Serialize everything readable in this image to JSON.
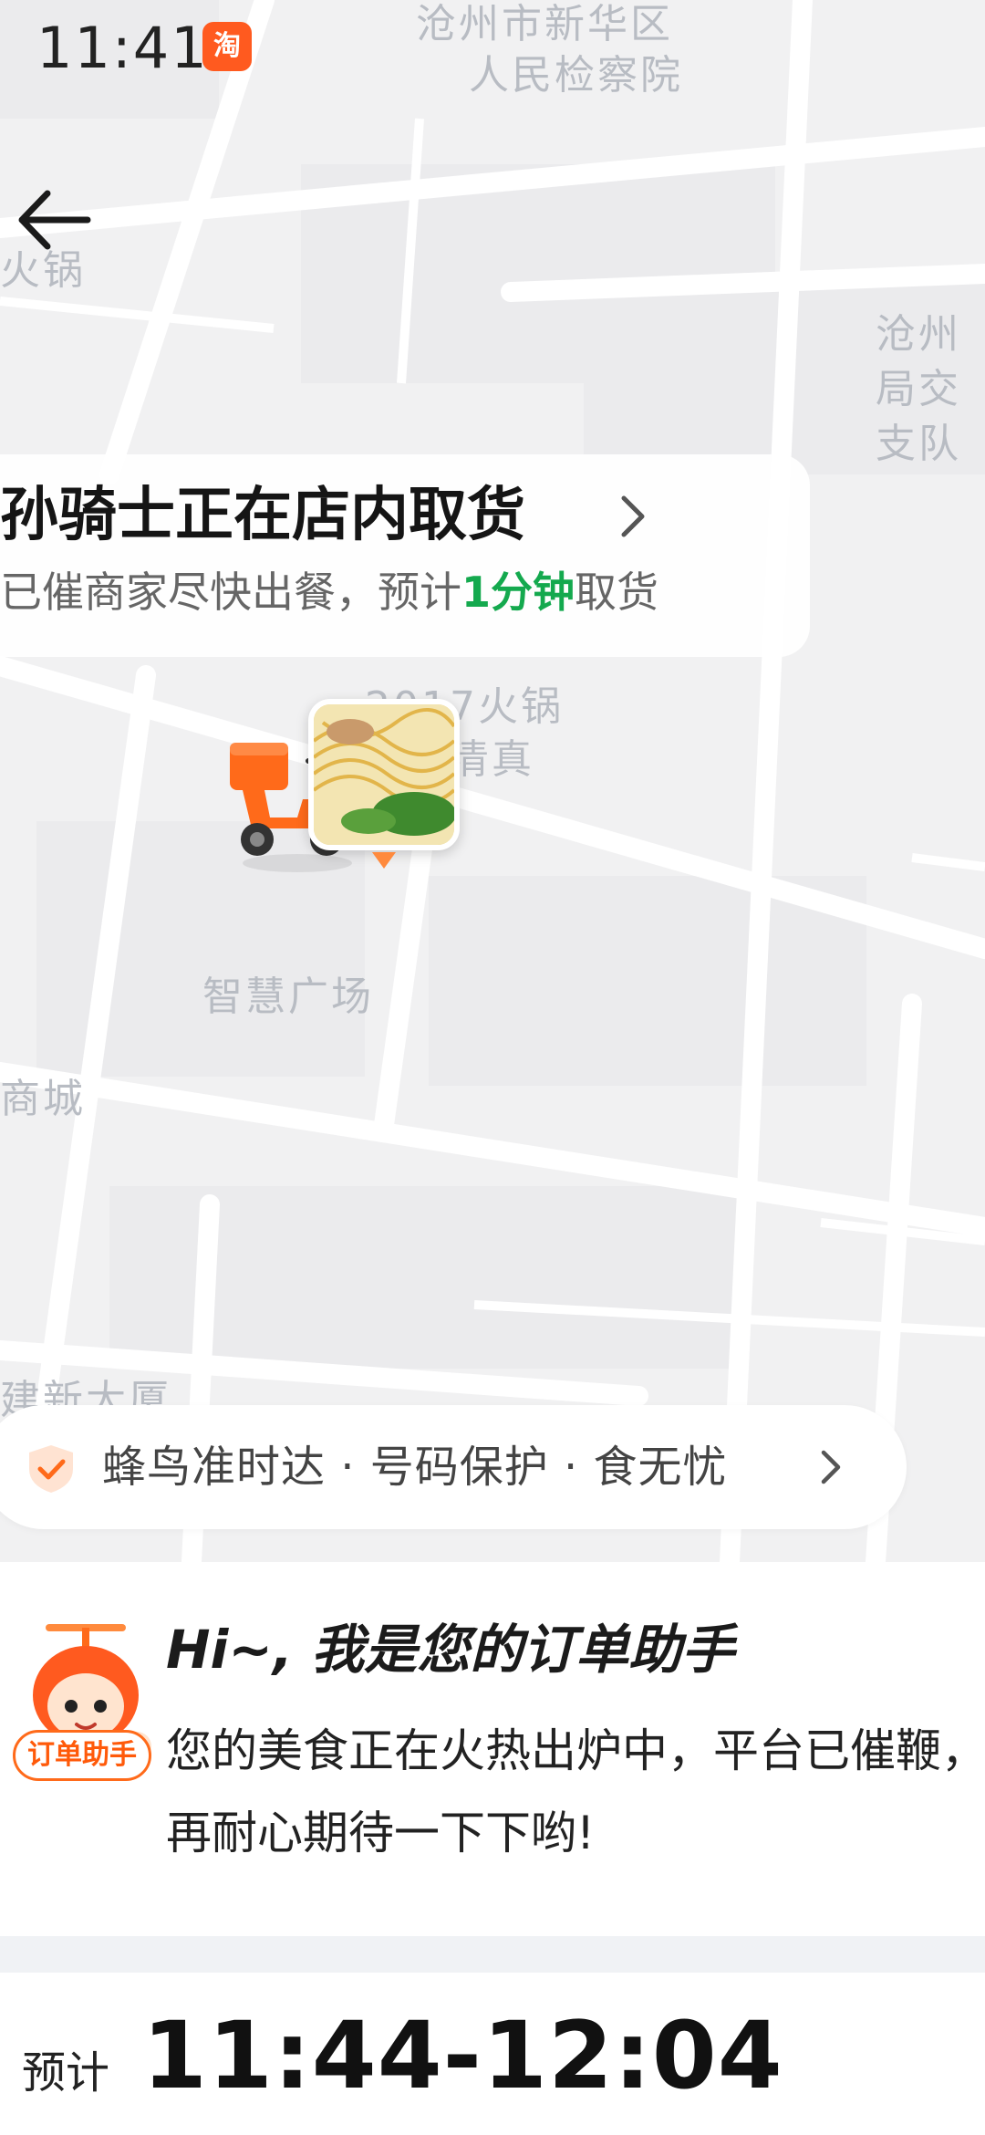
{
  "status_bar": {
    "time": "11:41",
    "app_icon_text": "淘"
  },
  "map": {
    "poi_labels": [
      "沧州市新华区",
      "人民检察院",
      "火锅",
      "沧州",
      "局交",
      "支队",
      "2017火锅",
      "清真",
      "智慧广场",
      "商城",
      "建新大厦"
    ]
  },
  "status_card": {
    "title": "孙骑士正在店内取货",
    "subtitle_prefix": "已催商家尽快出餐，预计",
    "subtitle_highlight": "1分钟",
    "subtitle_suffix": "取货",
    "highlight_color": "#14a94e"
  },
  "guarantee": {
    "text": "蜂鸟准时达 · 号码保护 · 食无忧"
  },
  "assistant": {
    "badge": "订单助手",
    "title": "Hi~, 我是您的订单助手",
    "message": "您的美食正在火热出炉中，平台已催鞭，请您再耐心期待一下下哟!"
  },
  "eta": {
    "label": "预计",
    "range": "11:44-12:04"
  },
  "colors": {
    "accent_orange": "#ff6a1a",
    "brand_green": "#14a94e"
  }
}
